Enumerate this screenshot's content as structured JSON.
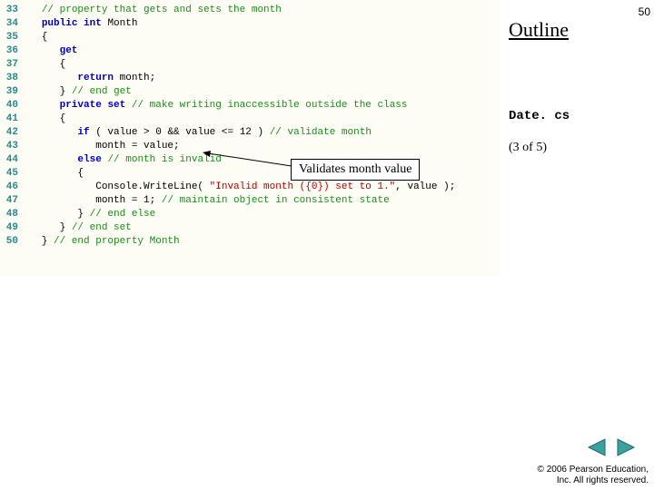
{
  "slide": {
    "number": "50",
    "outline_label": "Outline"
  },
  "sidebar": {
    "filename": "Date. cs",
    "progress": "(3 of 5)"
  },
  "callout": {
    "text": "Validates month value"
  },
  "copyright": {
    "line1": "© 2006 Pearson Education,",
    "line2": "Inc.  All rights reserved."
  },
  "nav": {
    "prev": "◀",
    "next": "▶"
  },
  "code": {
    "lines": [
      {
        "n": "33",
        "tokens": [
          [
            "   ",
            "p"
          ],
          [
            "// property that gets and sets the month",
            "c"
          ]
        ]
      },
      {
        "n": "34",
        "tokens": [
          [
            "   ",
            "p"
          ],
          [
            "public",
            "k"
          ],
          [
            " ",
            "p"
          ],
          [
            "int",
            "k"
          ],
          [
            " Month",
            "p"
          ]
        ]
      },
      {
        "n": "35",
        "tokens": [
          [
            "   {",
            "p"
          ]
        ]
      },
      {
        "n": "36",
        "tokens": [
          [
            "      ",
            "p"
          ],
          [
            "get",
            "k"
          ]
        ]
      },
      {
        "n": "37",
        "tokens": [
          [
            "      {",
            "p"
          ]
        ]
      },
      {
        "n": "38",
        "tokens": [
          [
            "         ",
            "p"
          ],
          [
            "return",
            "k"
          ],
          [
            " month;",
            "p"
          ]
        ]
      },
      {
        "n": "39",
        "tokens": [
          [
            "      } ",
            "p"
          ],
          [
            "// end get",
            "c"
          ]
        ]
      },
      {
        "n": "40",
        "tokens": [
          [
            "      ",
            "p"
          ],
          [
            "private",
            "k"
          ],
          [
            " ",
            "p"
          ],
          [
            "set",
            "k"
          ],
          [
            " ",
            "p"
          ],
          [
            "// make writing inaccessible outside the class",
            "c"
          ]
        ]
      },
      {
        "n": "41",
        "tokens": [
          [
            "      {",
            "p"
          ]
        ]
      },
      {
        "n": "42",
        "tokens": [
          [
            "         ",
            "p"
          ],
          [
            "if",
            "k"
          ],
          [
            " ( value > ",
            "p"
          ],
          [
            "0",
            "n"
          ],
          [
            " && value <= ",
            "p"
          ],
          [
            "12",
            "n"
          ],
          [
            " ) ",
            "p"
          ],
          [
            "// validate month",
            "c"
          ]
        ]
      },
      {
        "n": "43",
        "tokens": [
          [
            "            month = value;",
            "p"
          ]
        ]
      },
      {
        "n": "44",
        "tokens": [
          [
            "         ",
            "p"
          ],
          [
            "else",
            "k"
          ],
          [
            " ",
            "p"
          ],
          [
            "// month is invalid",
            "c"
          ]
        ]
      },
      {
        "n": "45",
        "tokens": [
          [
            "         {",
            "p"
          ]
        ]
      },
      {
        "n": "46",
        "tokens": [
          [
            "            Console.WriteLine( ",
            "p"
          ],
          [
            "\"Invalid month ({0}) set to 1.\"",
            "s"
          ],
          [
            ", value );",
            "p"
          ]
        ]
      },
      {
        "n": "47",
        "tokens": [
          [
            "            month = ",
            "p"
          ],
          [
            "1",
            "n"
          ],
          [
            "; ",
            "p"
          ],
          [
            "// maintain object in consistent state",
            "c"
          ]
        ]
      },
      {
        "n": "48",
        "tokens": [
          [
            "         } ",
            "p"
          ],
          [
            "// end else",
            "c"
          ]
        ]
      },
      {
        "n": "49",
        "tokens": [
          [
            "      } ",
            "p"
          ],
          [
            "// end set",
            "c"
          ]
        ]
      },
      {
        "n": "50",
        "tokens": [
          [
            "   } ",
            "p"
          ],
          [
            "// end property Month",
            "c"
          ]
        ]
      }
    ]
  }
}
